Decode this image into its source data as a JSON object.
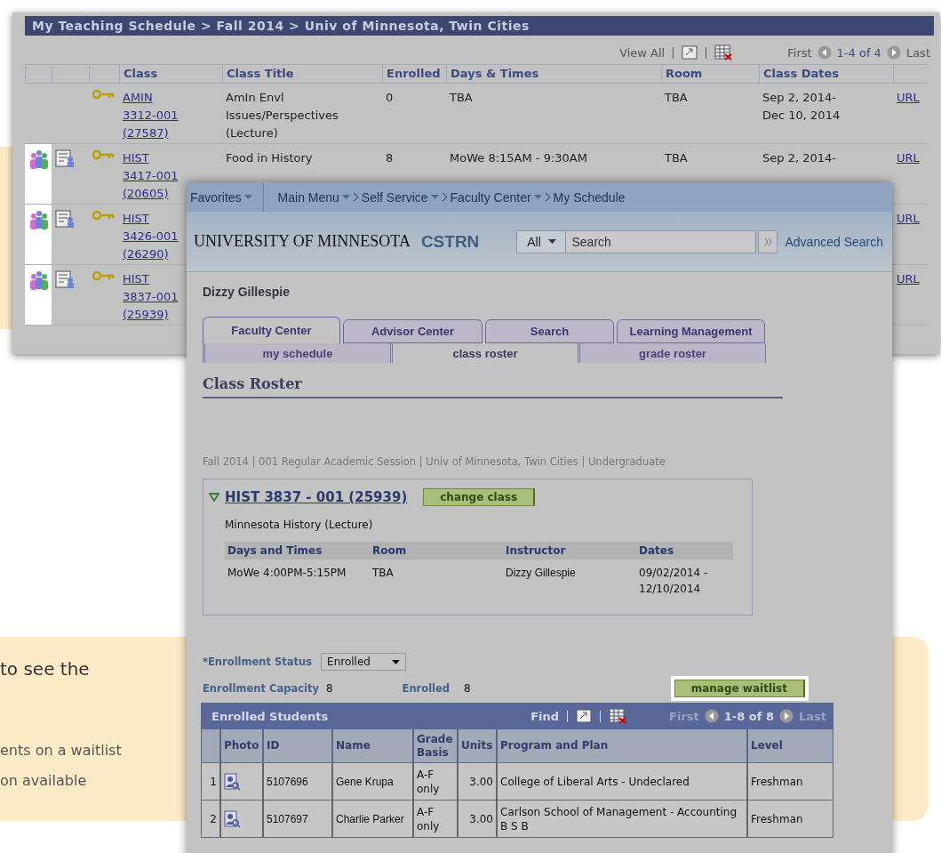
{
  "callouts": {
    "bottom": {
      "lines": [
        "to see the",
        "ents on a waitlist",
        "on available"
      ]
    }
  },
  "schedule": {
    "title": "My Teaching Schedule > Fall 2014 > Univ of Minnesota, Twin Cities",
    "toolbar": {
      "view_all": "View All",
      "first": "First",
      "range": "1-4 of 4",
      "last": "Last"
    },
    "columns": [
      "Class",
      "Class Title",
      "Enrolled",
      "Days & Times",
      "Room",
      "Class Dates"
    ],
    "rows": [
      {
        "has_roster": false,
        "highlighted": false,
        "class_lines": [
          "AMIN",
          "3312-001",
          "(27587)"
        ],
        "title": "AmIn Envl Issues/Perspectives (Lecture)",
        "enrolled": "0",
        "days": "TBA",
        "room": "TBA",
        "dates": [
          "Sep 2, 2014-",
          "Dec 10, 2014"
        ],
        "url": "URL"
      },
      {
        "has_roster": true,
        "highlighted": true,
        "class_lines": [
          "HIST",
          "3417-001",
          "(20605)"
        ],
        "title": "Food in History",
        "enrolled": "8",
        "days": "MoWe 8:15AM - 9:30AM",
        "room": "TBA",
        "dates": [
          "Sep 2, 2014-"
        ],
        "url": "URL"
      },
      {
        "has_roster": true,
        "highlighted": true,
        "class_lines": [
          "HIST",
          "3426-001",
          "(26290)"
        ],
        "url": "URL"
      },
      {
        "has_roster": true,
        "highlighted": true,
        "class_lines": [
          "HIST",
          "3837-001",
          "(25939)"
        ],
        "url": "URL"
      }
    ]
  },
  "roster": {
    "nav": [
      {
        "label": "Favorites",
        "dropdown": true
      },
      {
        "label": "Main Menu",
        "dropdown": true
      },
      {
        "label": "Self Service",
        "dropdown": true
      },
      {
        "label": "Faculty Center",
        "dropdown": true
      },
      {
        "label": "My Schedule",
        "dropdown": false
      }
    ],
    "logo": "UNIVERSITY OF MINNESOTA",
    "system": "CSTRN",
    "search_scope": "All",
    "search": {
      "placeholder": "Search"
    },
    "advanced_search": "Advanced Search",
    "user": "Dizzy Gillespie",
    "tabs": [
      {
        "label": "Faculty Center",
        "selected": true
      },
      {
        "label": "Advisor Center",
        "selected": false
      },
      {
        "label": "Search",
        "selected": false
      },
      {
        "label": "Learning Management",
        "selected": false
      }
    ],
    "subtabs": [
      {
        "label": "my schedule",
        "selected": false
      },
      {
        "label": "class roster",
        "selected": true
      },
      {
        "label": "grade roster",
        "selected": false
      }
    ],
    "heading": "Class Roster",
    "term": "Fall 2014 | 001 Regular Academic Session | Univ of Minnesota, Twin Cities | Undergraduate",
    "class_box": {
      "expanded": true,
      "link": "HIST 3837 - 001 (25939)",
      "button": "change class",
      "description": "Minnesota History (Lecture)",
      "columns": [
        "Days and Times",
        "Room",
        "Instructor",
        "Dates"
      ],
      "row": [
        "MoWe 4:00PM-5:15PM",
        "TBA",
        "Dizzy Gillespie",
        "09/02/2014 - 12/10/2014"
      ]
    },
    "status_label": "*Enrollment Status",
    "status_value": "Enrolled",
    "capacity_label": "Enrollment Capacity",
    "capacity": "8",
    "enrolled_label": "Enrolled",
    "enrolled": "8",
    "waitlist_button": {
      "label": "manage waitlist",
      "highlighted": true
    },
    "grid": {
      "title": "Enrolled Students",
      "find": "Find",
      "first": "First",
      "range": "1-8 of 8",
      "last": "Last",
      "columns": [
        "Photo",
        "ID",
        "Name",
        "Grade Basis",
        "Units",
        "Program and Plan",
        "Level"
      ],
      "rows": [
        {
          "number": "1",
          "id": "5107696",
          "name": "Gene Krupa",
          "grade": "A-F only",
          "units": "3.00",
          "program": "College of Liberal Arts - Undeclared",
          "level": "Freshman"
        },
        {
          "number": "2",
          "id": "5107697",
          "name": "Charlie Parker",
          "grade": "A-F only",
          "units": "3.00",
          "program": "Carlson School of Management - Accounting B S B",
          "level": "Freshman"
        }
      ]
    }
  }
}
